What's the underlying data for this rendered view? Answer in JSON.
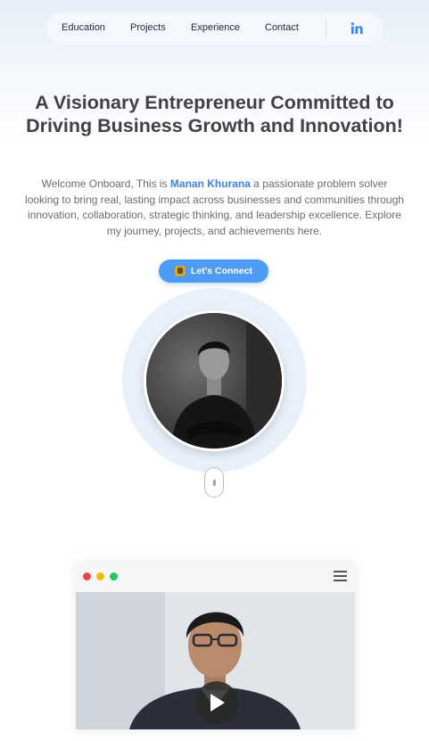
{
  "nav": {
    "items": [
      {
        "label": "Education"
      },
      {
        "label": "Projects"
      },
      {
        "label": "Experience"
      },
      {
        "label": "Contact"
      }
    ],
    "social_icon": "linkedin-icon",
    "accent": "#3b82f6"
  },
  "hero": {
    "headline": "A Visionary Entrepreneur Committed to Driving Business Growth and Innovation!",
    "intro_before": "Welcome Onboard, This is ",
    "name": "Manan Khurana",
    "intro_after": " a passionate problem solver looking to bring real, lasting impact across businesses and communities through innovation, collaboration, strategic thinking, and leadership excellence. Explore my journey, projects, and achievements here.",
    "cta_label": "Let's Connect",
    "cta_icon": "handshake-icon",
    "cta_color": "#4e9bf5"
  },
  "portrait": {
    "icon": "profile-photo"
  },
  "scroll": {
    "icon": "mouse-scroll-icon"
  },
  "video_card": {
    "window_dots": [
      "#ef4444",
      "#f5b90b",
      "#22c55e"
    ],
    "menu_icon": "hamburger-menu-icon",
    "play_icon": "play-icon"
  }
}
